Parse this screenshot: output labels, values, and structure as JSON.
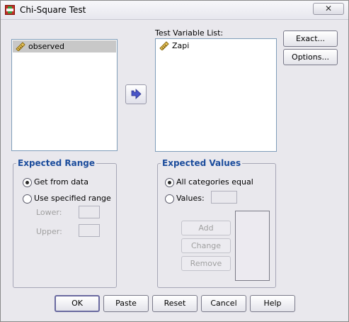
{
  "window": {
    "title": "Chi-Square Test",
    "close_label": "✕"
  },
  "source_list": {
    "items": [
      "observed"
    ]
  },
  "test_variable": {
    "label": "Test Variable List:",
    "items": [
      "Zapi"
    ]
  },
  "side_buttons": {
    "exact": "Exact...",
    "options": "Options..."
  },
  "expected_range": {
    "title": "Expected Range",
    "get_from_data": "Get from data",
    "use_specified": "Use specified range",
    "lower_label": "Lower:",
    "upper_label": "Upper:",
    "selected": "get_from_data"
  },
  "expected_values": {
    "title": "Expected Values",
    "all_equal": "All categories equal",
    "values_label": "Values:",
    "add": "Add",
    "change": "Change",
    "remove": "Remove",
    "selected": "all_equal"
  },
  "bottom_buttons": {
    "ok": "OK",
    "paste": "Paste",
    "reset": "Reset",
    "cancel": "Cancel",
    "help": "Help"
  }
}
